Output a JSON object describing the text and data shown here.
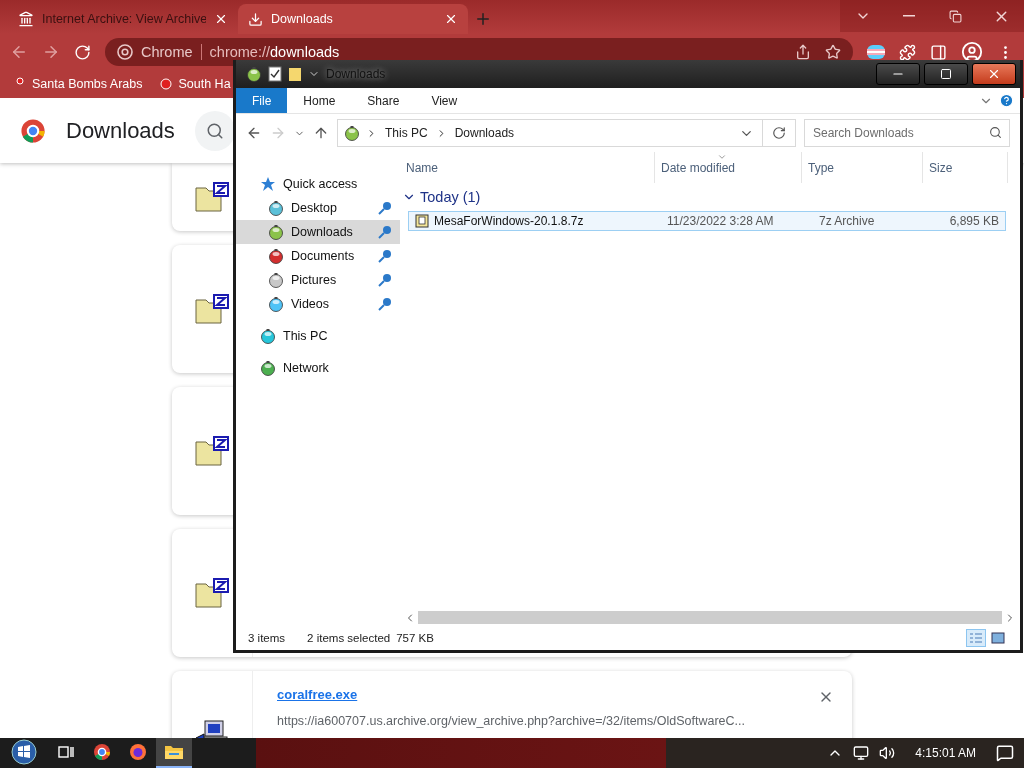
{
  "browser": {
    "tabs": [
      {
        "title": "Internet Archive: View Archive",
        "selected": false
      },
      {
        "title": "Downloads",
        "selected": true
      }
    ],
    "address": {
      "label": "Chrome",
      "url_prefix": "chrome://",
      "url_main": "downloads"
    },
    "bookmarks": [
      "Santa Bombs Arabs",
      "South Ha"
    ],
    "page": {
      "title": "Downloads",
      "downloads": [
        {
          "kind": "archive"
        },
        {
          "kind": "archive"
        },
        {
          "kind": "archive"
        },
        {
          "kind": "archive"
        },
        {
          "kind": "program",
          "file": "coralfree.exe",
          "url": "https://ia600707.us.archive.org/view_archive.php?archive=/32/items/OldSoftwareC..."
        }
      ]
    }
  },
  "explorer": {
    "title": "Downloads",
    "ribbon_tabs": [
      {
        "label": "File",
        "selected": true
      },
      {
        "label": "Home",
        "selected": false
      },
      {
        "label": "Share",
        "selected": false
      },
      {
        "label": "View",
        "selected": false
      }
    ],
    "breadcrumb": [
      "This PC",
      "Downloads"
    ],
    "search": {
      "placeholder": "Search Downloads"
    },
    "nav": [
      {
        "label": "Quick access",
        "kind": "star",
        "selected": false,
        "children": [
          {
            "label": "Desktop",
            "kind": "desktop",
            "selected": false,
            "pinned": true
          },
          {
            "label": "Downloads",
            "kind": "downloads",
            "selected": true,
            "pinned": true
          },
          {
            "label": "Documents",
            "kind": "documents",
            "selected": false,
            "pinned": true
          },
          {
            "label": "Pictures",
            "kind": "pictures",
            "selected": false,
            "pinned": true
          },
          {
            "label": "Videos",
            "kind": "videos",
            "selected": false,
            "pinned": true
          }
        ]
      },
      {
        "label": "This PC",
        "kind": "pc",
        "selected": false
      },
      {
        "label": "Network",
        "kind": "network",
        "selected": false
      }
    ],
    "columns": [
      "Name",
      "Date modified",
      "Type",
      "Size"
    ],
    "groups": [
      {
        "label": "Today (1)",
        "expanded": true,
        "rows": [
          {
            "name": "MesaForWindows-20.1.8.7z",
            "date": "11/23/2022 3:28 AM",
            "type": "7z Archive",
            "size": "6,895 KB",
            "selected": true
          }
        ]
      }
    ],
    "status": [
      "3 items",
      "2 items selected",
      "757 KB"
    ],
    "view_buttons": [
      {
        "kind": "details",
        "selected": true
      },
      {
        "kind": "large-icons",
        "selected": false
      }
    ]
  },
  "taskbar": {
    "apps": [
      {
        "kind": "task-view",
        "active": false
      },
      {
        "kind": "chrome",
        "active": false
      },
      {
        "kind": "firefox",
        "active": false
      },
      {
        "kind": "explorer",
        "active": true
      }
    ],
    "clock": "4:15:01 AM"
  }
}
